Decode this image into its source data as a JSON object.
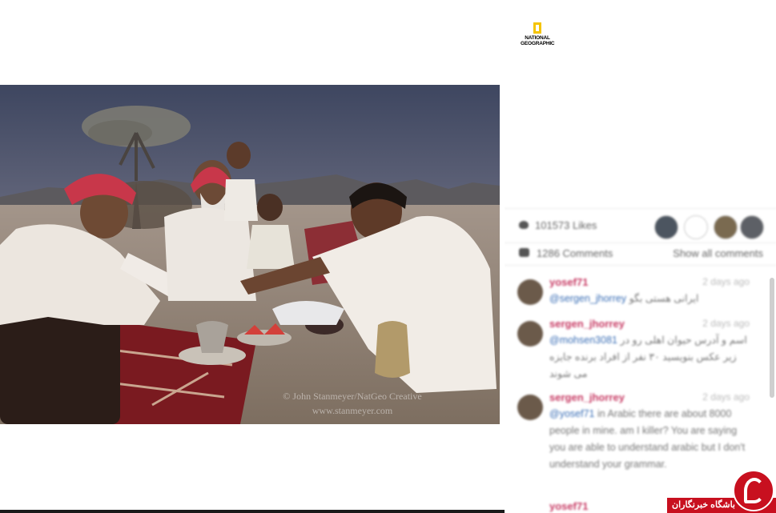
{
  "publisher_logo": {
    "line1": "NATIONAL",
    "line2": "GEOGRAPHIC",
    "accent_color": "#f5c400"
  },
  "photo": {
    "watermark_line1": "© John Stanmeyer/NatGeo Creative",
    "watermark_line2": "www.stanmeyer.com"
  },
  "post_panel": {
    "likes_text": "101573 Likes",
    "comments_count": "1286 Comments",
    "show_all_label": "Show all comments",
    "heart_icon": "heart-icon",
    "comment_icon": "comment-bubble-icon",
    "comments": [
      {
        "username": "yosef71",
        "time": "2 days ago",
        "mention": "@sergen_jhorrey",
        "text": "ایرانی هستی بگو"
      },
      {
        "username": "sergen_jhorrey",
        "time": "2 days ago",
        "mention": "@mohsen3081",
        "text": "اسم و آدرس حیوان اهلی رو در زیر عکس بنویسید ۳۰ نفر از افراد برنده جایزه می شوند"
      },
      {
        "username": "sergen_jhorrey",
        "time": "2 days ago",
        "mention": "@yosef71",
        "text": "in Arabic there are about 8000 people in mine. am I killer? You are saying you are able to understand arabic but I don't understand your grammar."
      }
    ],
    "next_username": "yosef71"
  },
  "site_badge": {
    "text": "باشگاه خبرنگاران",
    "color": "#c8101f"
  }
}
